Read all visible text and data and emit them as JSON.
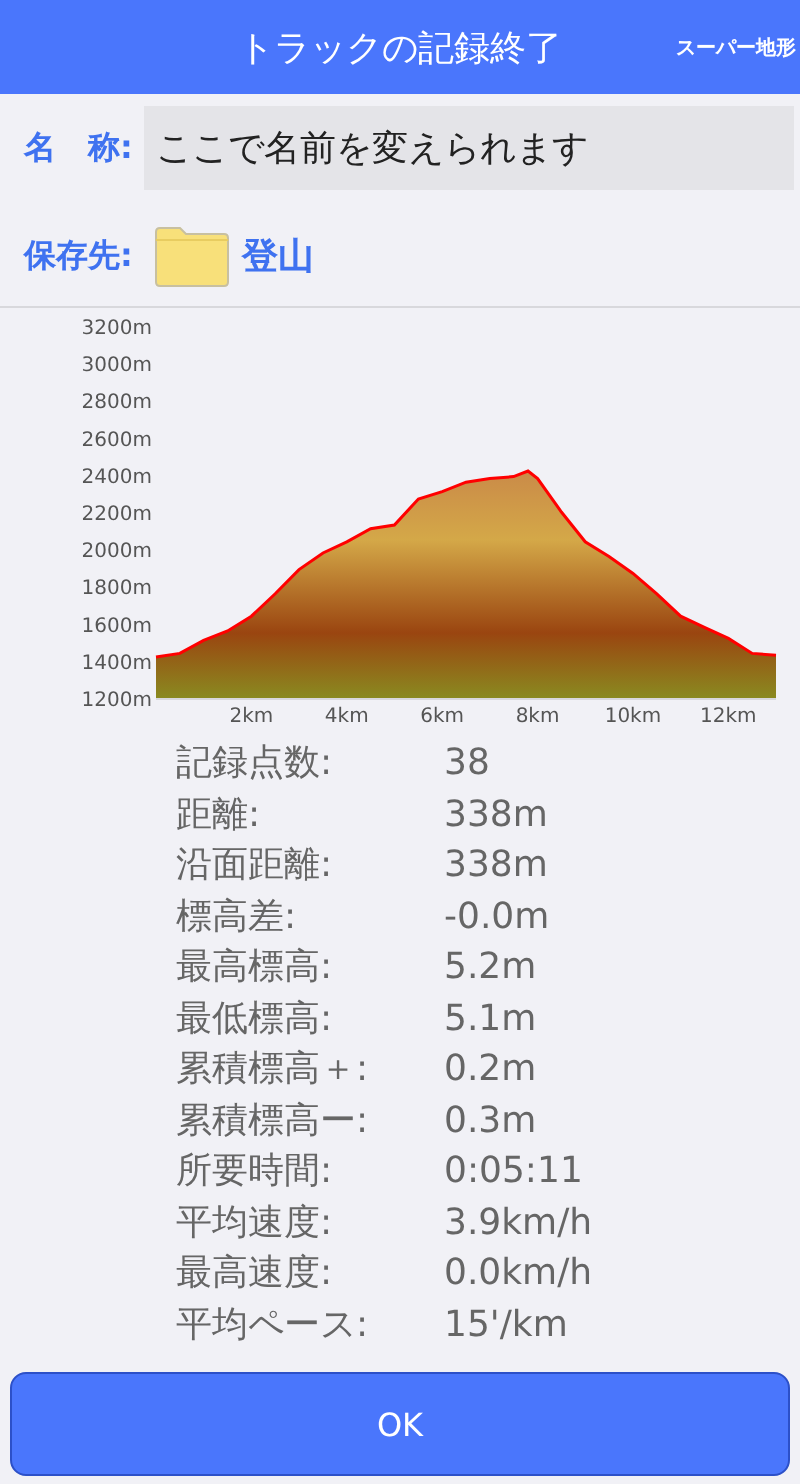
{
  "header": {
    "title": "トラックの記録終了",
    "right_text": "スーパー地形"
  },
  "name_row": {
    "label": "名　称:",
    "value": "ここで名前を変えられます"
  },
  "folder_row": {
    "label": "保存先:",
    "folder": "登山"
  },
  "elevation": {
    "chart_data": {
      "type": "area",
      "x": [
        0,
        0.5,
        1,
        1.5,
        2,
        2.5,
        3,
        3.5,
        4,
        4.5,
        5,
        5.5,
        6,
        6.5,
        7,
        7.5,
        7.8,
        8,
        8.5,
        9,
        9.5,
        10,
        10.5,
        11,
        11.5,
        12,
        12.5,
        13
      ],
      "series": [
        {
          "color": "#ff0000",
          "values": [
            1420,
            1440,
            1510,
            1560,
            1640,
            1760,
            1890,
            1980,
            2040,
            2110,
            2130,
            2270,
            2310,
            2360,
            2380,
            2390,
            2420,
            2380,
            2200,
            2040,
            1960,
            1870,
            1760,
            1640,
            1580,
            1520,
            1440,
            1430
          ]
        }
      ],
      "xlim": [
        0,
        13
      ],
      "ylim": [
        1200,
        3200
      ],
      "xticks": [
        {
          "value": 2,
          "label": "2km"
        },
        {
          "value": 4,
          "label": "4km"
        },
        {
          "value": 6,
          "label": "6km"
        },
        {
          "value": 8,
          "label": "8km"
        },
        {
          "value": 10,
          "label": "10km"
        },
        {
          "value": 12,
          "label": "12km"
        }
      ],
      "yticks": [
        {
          "value": 1200,
          "label": "1200m"
        },
        {
          "value": 1400,
          "label": "1400m"
        },
        {
          "value": 1600,
          "label": "1600m"
        },
        {
          "value": 1800,
          "label": "1800m"
        },
        {
          "value": 2000,
          "label": "2000m"
        },
        {
          "value": 2200,
          "label": "2200m"
        },
        {
          "value": 2400,
          "label": "2400m"
        },
        {
          "value": 2600,
          "label": "2600m"
        },
        {
          "value": 2800,
          "label": "2800m"
        },
        {
          "value": 3000,
          "label": "3000m"
        },
        {
          "value": 3200,
          "label": "3200m"
        }
      ]
    }
  },
  "stats": [
    {
      "label": "記録点数:",
      "value": "38"
    },
    {
      "label": "距離:",
      "value": "338m"
    },
    {
      "label": "沿面距離:",
      "value": "338m"
    },
    {
      "label": "標高差:",
      "value": "-0.0m"
    },
    {
      "label": "最高標高:",
      "value": "5.2m"
    },
    {
      "label": "最低標高:",
      "value": "5.1m"
    },
    {
      "label": "累積標高＋:",
      "value": "0.2m"
    },
    {
      "label": "累積標高ー:",
      "value": "0.3m"
    },
    {
      "label": "所要時間:",
      "value": "0:05:11"
    },
    {
      "label": "平均速度:",
      "value": "3.9km/h"
    },
    {
      "label": "最高速度:",
      "value": "0.0km/h"
    },
    {
      "label": "平均ペース:",
      "value": "15'/km"
    }
  ],
  "ok_button": "OK"
}
